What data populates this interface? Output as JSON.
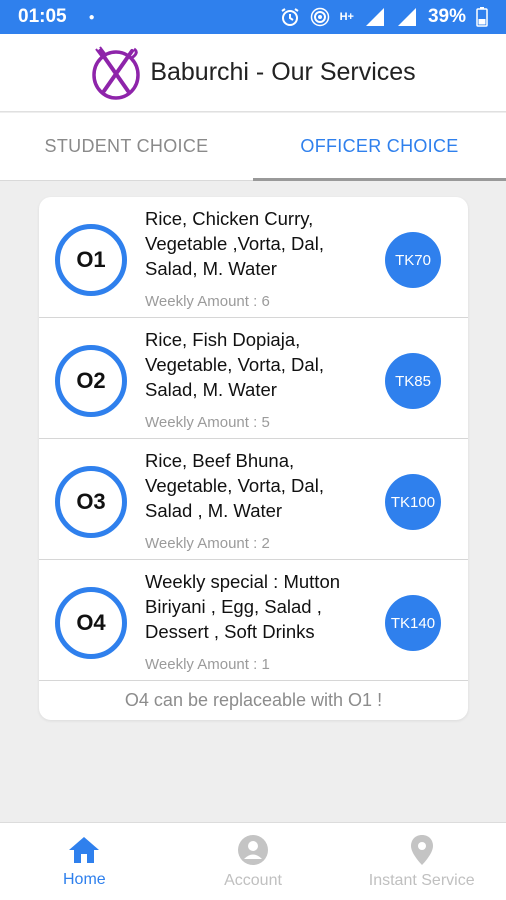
{
  "status_bar": {
    "time": "01:05",
    "battery": "39%",
    "network": "H+"
  },
  "app_bar": {
    "title": "Baburchi - Our Services",
    "logo_icon": "plate-fork-knife-icon"
  },
  "tabs": [
    {
      "label": "STUDENT CHOICE",
      "active": false
    },
    {
      "label": "OFFICER CHOICE",
      "active": true
    }
  ],
  "packages": [
    {
      "code": "O1",
      "items": "Rice, Chicken Curry, Vegetable ,Vorta, Dal, Salad, M. Water",
      "weekly": "Weekly Amount : 6",
      "price": "TK70"
    },
    {
      "code": "O2",
      "items": "Rice, Fish Dopiaja, Vegetable, Vorta, Dal, Salad, M. Water",
      "weekly": "Weekly Amount : 5",
      "price": "TK85"
    },
    {
      "code": "O3",
      "items": "Rice, Beef Bhuna, Vegetable, Vorta, Dal, Salad , M. Water",
      "weekly": "Weekly Amount : 2",
      "price": "TK100"
    },
    {
      "code": "O4",
      "items": "Weekly special : Mutton Biriyani , Egg, Salad , Dessert , Soft Drinks",
      "weekly": "Weekly Amount : 1",
      "price": "TK140"
    }
  ],
  "note": "O4 can be replaceable with O1 !",
  "bottom_nav": [
    {
      "label": "Home",
      "icon": "home-icon",
      "active": true
    },
    {
      "label": "Account",
      "icon": "account-icon",
      "active": false
    },
    {
      "label": "Instant Service",
      "icon": "location-pin-icon",
      "active": false
    }
  ],
  "colors": {
    "accent": "#2f80ed",
    "logo": "#8e24aa"
  }
}
